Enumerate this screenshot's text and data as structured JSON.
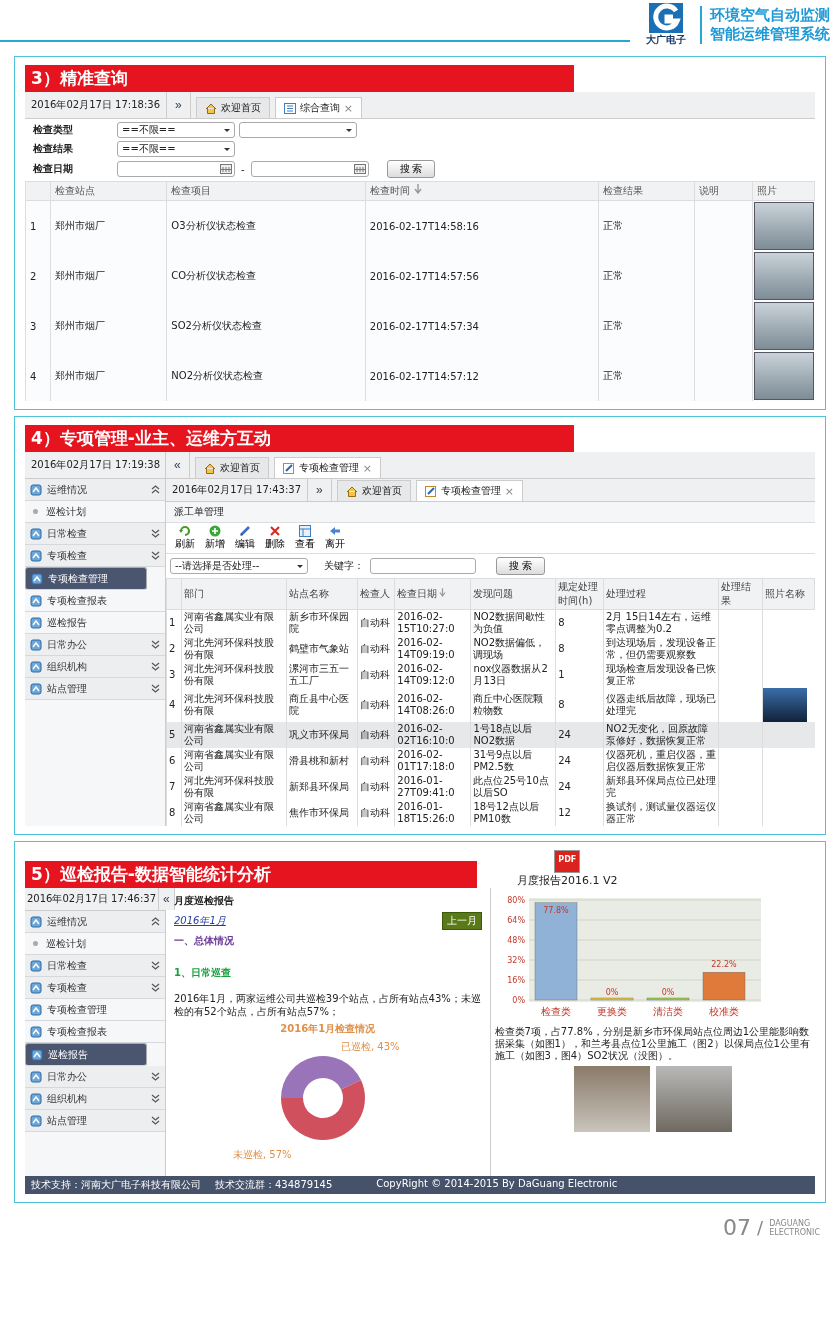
{
  "header": {
    "brand": "大广电子",
    "title_lines": [
      "环境空气自动监测",
      "智能运维管理系统"
    ]
  },
  "query_section": {
    "heading": "3）精准查询",
    "datetime": "2016年02月17日 17:18:36",
    "nav_glyph": "»",
    "tabs": [
      {
        "label": "欢迎首页",
        "kind": "home",
        "selected": false
      },
      {
        "label": "综合查询",
        "kind": "list",
        "selected": true,
        "close": "×"
      }
    ],
    "filters": [
      {
        "label": "检查类型",
        "kind": "select2",
        "value": "==不限=="
      },
      {
        "label": "检查结果",
        "kind": "select",
        "value": "==不限=="
      },
      {
        "label": "检查日期",
        "kind": "daterange",
        "separator": "-"
      }
    ],
    "search_button": "搜 索",
    "columns": [
      {
        "label": "检查站点",
        "sorted": false
      },
      {
        "label": "检查项目",
        "sorted": false
      },
      {
        "label": "检查时间",
        "sorted": true
      },
      {
        "label": "检查结果",
        "sorted": false
      },
      {
        "label": "说明",
        "sorted": false
      },
      {
        "label": "照片",
        "sorted": false
      }
    ],
    "rows": [
      {
        "index": "1",
        "station": "郑州市烟厂",
        "item": "O3分析仪状态检查",
        "time": "2016-02-17T14:58:16",
        "result": "正常"
      },
      {
        "index": "2",
        "station": "郑州市烟厂",
        "item": "CO分析仪状态检查",
        "time": "2016-02-17T14:57:56",
        "result": "正常"
      },
      {
        "index": "3",
        "station": "郑州市烟厂",
        "item": "SO2分析仪状态检查",
        "time": "2016-02-17T14:57:34",
        "result": "正常"
      },
      {
        "index": "4",
        "station": "郑州市烟厂",
        "item": "NO2分析仪状态检查",
        "time": "2016-02-17T14:57:12",
        "result": "正常"
      }
    ]
  },
  "special_section": {
    "heading": "4）专项管理-业主、运维方互动",
    "outer": {
      "datetime": "2016年02月17日 17:19:38",
      "nav_glyph": "«",
      "tabs": [
        {
          "label": "欢迎首页",
          "kind": "home",
          "selected": false
        },
        {
          "label": "专项检查管理",
          "kind": "edit",
          "selected": true,
          "close": "×"
        }
      ]
    },
    "sidebar": [
      {
        "label": "运维情况",
        "kind": "group",
        "expanded": true,
        "selected": false
      },
      {
        "label": "巡检计划",
        "kind": "sub",
        "selected": false
      },
      {
        "label": "日常检查",
        "kind": "group",
        "expanded": false,
        "selected": false
      },
      {
        "label": "专项检查",
        "kind": "group",
        "expanded": false,
        "selected": false
      },
      {
        "label": "专项检查管理",
        "kind": "link",
        "selected": true
      },
      {
        "label": "专项检查报表",
        "kind": "link",
        "selected": false
      },
      {
        "label": "巡检报告",
        "kind": "link",
        "selected": false
      },
      {
        "label": "日常办公",
        "kind": "group",
        "expanded": false,
        "selected": false
      },
      {
        "label": "组织机构",
        "kind": "group",
        "expanded": false,
        "selected": false
      },
      {
        "label": "站点管理",
        "kind": "group",
        "expanded": false,
        "selected": false
      }
    ],
    "inner": {
      "datetime": "2016年02月17日 17:43:37",
      "nav_glyph": "»",
      "tabs": [
        {
          "label": "欢迎首页",
          "kind": "home",
          "selected": false
        },
        {
          "label": "专项检查管理",
          "kind": "edit",
          "selected": true,
          "close": "×"
        }
      ],
      "panel_title": "派工单管理",
      "toolbar": [
        {
          "label": "刷新",
          "kind": "refresh"
        },
        {
          "label": "新增",
          "kind": "add"
        },
        {
          "label": "编辑",
          "kind": "edit"
        },
        {
          "label": "删除",
          "kind": "delete"
        },
        {
          "label": "查看",
          "kind": "view"
        },
        {
          "label": "离开",
          "kind": "exit"
        }
      ],
      "filter_select": "--请选择是否处理--",
      "keyword_label": "关键字：",
      "search_button": "搜 索",
      "columns": [
        {
          "label": "部门",
          "sorted": false
        },
        {
          "label": "站点名称",
          "sorted": false
        },
        {
          "label": "检查人",
          "sorted": false
        },
        {
          "label": "检查日期",
          "sorted": true
        },
        {
          "label": "发现问题",
          "sorted": false
        },
        {
          "label": "规定处理时间(h)",
          "sorted": false
        },
        {
          "label": "处理过程",
          "sorted": false
        },
        {
          "label": "处理结果",
          "sorted": false
        },
        {
          "label": "照片名称",
          "sorted": false
        }
      ],
      "rows": [
        {
          "index": "1",
          "cells": [
            "河南省鑫属实业有限公司",
            "新乡市环保园院",
            "自动科",
            "2016-02-15T10:27:0",
            "NO2数据间歇性为负值",
            "8",
            "2月 15日14左右，运维零点调整为0.2"
          ],
          "photo": false,
          "selected": false
        },
        {
          "index": "2",
          "cells": [
            "河北先河环保科技股份有限",
            "鹤壁市气象站",
            "自动科",
            "2016-02-14T09:19:0",
            "NO2数据偏低，调现场",
            "8",
            "到达现场后，发现设备正常，但仍需要观察数"
          ],
          "photo": false,
          "selected": false
        },
        {
          "index": "3",
          "cells": [
            "河北先河环保科技股份有限",
            "漯河市三五一五工厂",
            "自动科",
            "2016-02-14T09:12:0",
            "nox仪器数据从2月13日",
            "1",
            "现场检查后发现设备已恢复正常"
          ],
          "photo": false,
          "selected": false
        },
        {
          "index": "4",
          "cells": [
            "河北先河环保科技股份有限",
            "商丘县中心医院",
            "自动科",
            "2016-02-14T08:26:0",
            "商丘中心医院颗粒物数",
            "8",
            "仪器走纸后故障，现场已处理完"
          ],
          "photo": true,
          "selected": false
        },
        {
          "index": "5",
          "cells": [
            "河南省鑫属实业有限公司",
            "巩义市环保局",
            "自动科",
            "2016-02-02T16:10:0",
            "1号18点以后NO2数据",
            "24",
            "NO2无变化，回原故障泵修好，数据恢复正常"
          ],
          "photo": false,
          "selected": true
        },
        {
          "index": "6",
          "cells": [
            "河南省鑫属实业有限公司",
            "滑县桃和新村",
            "自动科",
            "2016-02-01T17:18:0",
            "31号9点以后PM2.5数",
            "24",
            "仪器死机，重启仪器，重启仪器后数据恢复正常"
          ],
          "photo": false,
          "selected": false
        },
        {
          "index": "7",
          "cells": [
            "河北先河环保科技股份有限",
            "新郑县环保局",
            "自动科",
            "2016-01-27T09:41:0",
            "此点位25号10点以后SO",
            "24",
            "新郑县环保局点位已处理完"
          ],
          "photo": false,
          "selected": false
        },
        {
          "index": "8",
          "cells": [
            "河南省鑫属实业有限公司",
            "焦作市环保局",
            "自动科",
            "2016-01-18T15:26:0",
            "18号12点以后 PM10数",
            "12",
            "换试剂，测试量仪器运仪器正常"
          ],
          "photo": false,
          "selected": false
        }
      ]
    }
  },
  "report_section": {
    "heading": "5）巡检报告-数据智能统计分析",
    "datetime": "2016年02月17日 17:46:37",
    "nav_glyph": "«",
    "sidebar": [
      {
        "label": "运维情况",
        "kind": "group",
        "expanded": true,
        "selected": false
      },
      {
        "label": "巡检计划",
        "kind": "sub",
        "selected": false
      },
      {
        "label": "日常检查",
        "kind": "group",
        "expanded": false,
        "selected": false
      },
      {
        "label": "专项检查",
        "kind": "group",
        "expanded": false,
        "selected": false
      },
      {
        "label": "专项检查管理",
        "kind": "link",
        "selected": false
      },
      {
        "label": "专项检查报表",
        "kind": "link",
        "selected": false
      },
      {
        "label": "巡检报告",
        "kind": "link",
        "selected": true
      },
      {
        "label": "日常办公",
        "kind": "group",
        "expanded": false,
        "selected": false
      },
      {
        "label": "组织机构",
        "kind": "group",
        "expanded": false,
        "selected": false
      },
      {
        "label": "站点管理",
        "kind": "group",
        "expanded": false,
        "selected": false
      }
    ],
    "report": {
      "title": "月度巡检报告",
      "month": "2016年1月",
      "prev_button": "上一月",
      "section_title": "一、总体情况",
      "subsection_title": "1、日常巡查",
      "paragraph": "2016年1月，两家运维公司共巡检39个站点，占所有站点43%；未巡检的有52个站点，占所有站点57%；",
      "chart_data": {
        "type": "donut",
        "title": "2016年1月检查情况",
        "values": [
          43,
          57
        ],
        "value_labels": [
          "已巡检, 43%",
          "未巡检, 57%"
        ]
      }
    },
    "analysis": {
      "pdf_label": "PDF",
      "title": "月度报告2016.1 V2",
      "chart_data": {
        "type": "bar",
        "categories": [
          "检查类",
          "更换类",
          "清洁类",
          "校准类"
        ],
        "values": [
          77.8,
          0,
          0,
          22.2
        ],
        "ylim": [
          0,
          80
        ],
        "grid": true,
        "yticks": [
          {
            "value": 0,
            "label": "0%"
          },
          {
            "value": 16,
            "label": "16%"
          },
          {
            "value": 32,
            "label": "32%"
          },
          {
            "value": 48,
            "label": "48%"
          },
          {
            "value": 64,
            "label": "64%"
          },
          {
            "value": 80,
            "label": "80%"
          }
        ],
        "value_labels": [
          "77.8%",
          "0%",
          "0%",
          "22.2%"
        ]
      },
      "summary": "检查类7项，占77.8%，分别是新乡市环保局站点位周边1公里能影响数据采集（如图1），和兰考县点位1公里施工（图2）以保局点位1公里有施工（如图3，图4）SO2状况（没图）。"
    },
    "footer_bar": {
      "support": "技术支持：河南大广电子科技有限公司",
      "group": "技术交流群：434879145",
      "copyright": "CopyRight © 2014-2015 By DaGuang Electronic"
    }
  },
  "page_footer": {
    "number": "07",
    "slash": "/",
    "brand_lines": [
      "DAGUANG",
      "ELECTRONIC"
    ]
  }
}
